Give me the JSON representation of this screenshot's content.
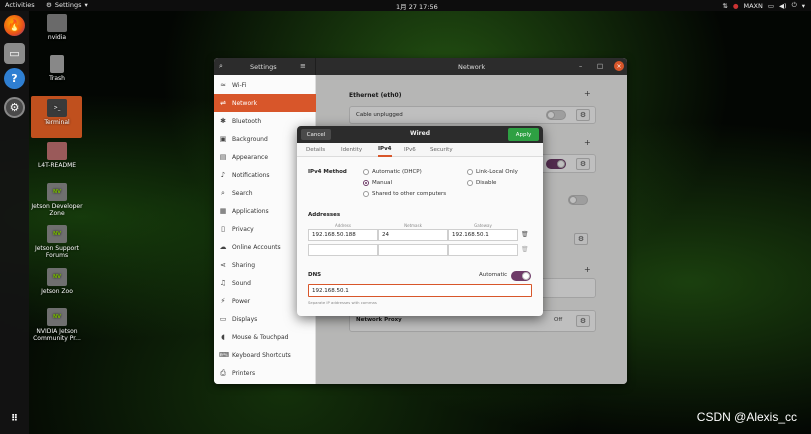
{
  "topbar": {
    "activities": "Activities",
    "app": "Settings",
    "clock": "1月 27  17:56",
    "tray_label": "MAXN"
  },
  "desktop": {
    "icons": [
      {
        "label": "nvidia"
      },
      {
        "label": "Trash"
      },
      {
        "label": "Terminal"
      },
      {
        "label": "L4T-README"
      },
      {
        "label": "Jetson Developer Zone"
      },
      {
        "label": "Jetson Support Forums"
      },
      {
        "label": "Jetson Zoo"
      },
      {
        "label": "NVIDIA Jetson Community Pr..."
      }
    ]
  },
  "settings": {
    "title": "Settings",
    "pane_title": "Network",
    "sidebar": [
      {
        "label": "Wi-Fi"
      },
      {
        "label": "Network"
      },
      {
        "label": "Bluetooth"
      },
      {
        "label": "Background"
      },
      {
        "label": "Appearance"
      },
      {
        "label": "Notifications"
      },
      {
        "label": "Search"
      },
      {
        "label": "Applications"
      },
      {
        "label": "Privacy"
      },
      {
        "label": "Online Accounts"
      },
      {
        "label": "Sharing"
      },
      {
        "label": "Sound"
      },
      {
        "label": "Power"
      },
      {
        "label": "Displays"
      },
      {
        "label": "Mouse & Touchpad"
      },
      {
        "label": "Keyboard Shortcuts"
      },
      {
        "label": "Printers"
      }
    ],
    "ethernet_header": "Ethernet (eth0)",
    "cable_status": "Cable unplugged",
    "proxy_label": "Network Proxy",
    "proxy_value": "Off"
  },
  "dialog": {
    "title": "Wired",
    "cancel": "Cancel",
    "apply": "Apply",
    "tabs": [
      "Details",
      "Identity",
      "IPv4",
      "IPv6",
      "Security"
    ],
    "ipv4_method_label": "IPv4 Method",
    "methods": {
      "auto": "Automatic (DHCP)",
      "link_local": "Link-Local Only",
      "manual": "Manual",
      "disable": "Disable",
      "shared": "Shared to other computers"
    },
    "addresses_label": "Addresses",
    "columns": {
      "address": "Address",
      "netmask": "Netmask",
      "gateway": "Gateway"
    },
    "row1": {
      "address": "192.168.50.188",
      "netmask": "24",
      "gateway": "192.168.50.1"
    },
    "dns_label": "DNS",
    "dns_auto_label": "Automatic",
    "dns_value": "192.168.50.1",
    "dns_hint": "Separate IP addresses with commas"
  },
  "watermark": "CSDN @Alexis_cc"
}
